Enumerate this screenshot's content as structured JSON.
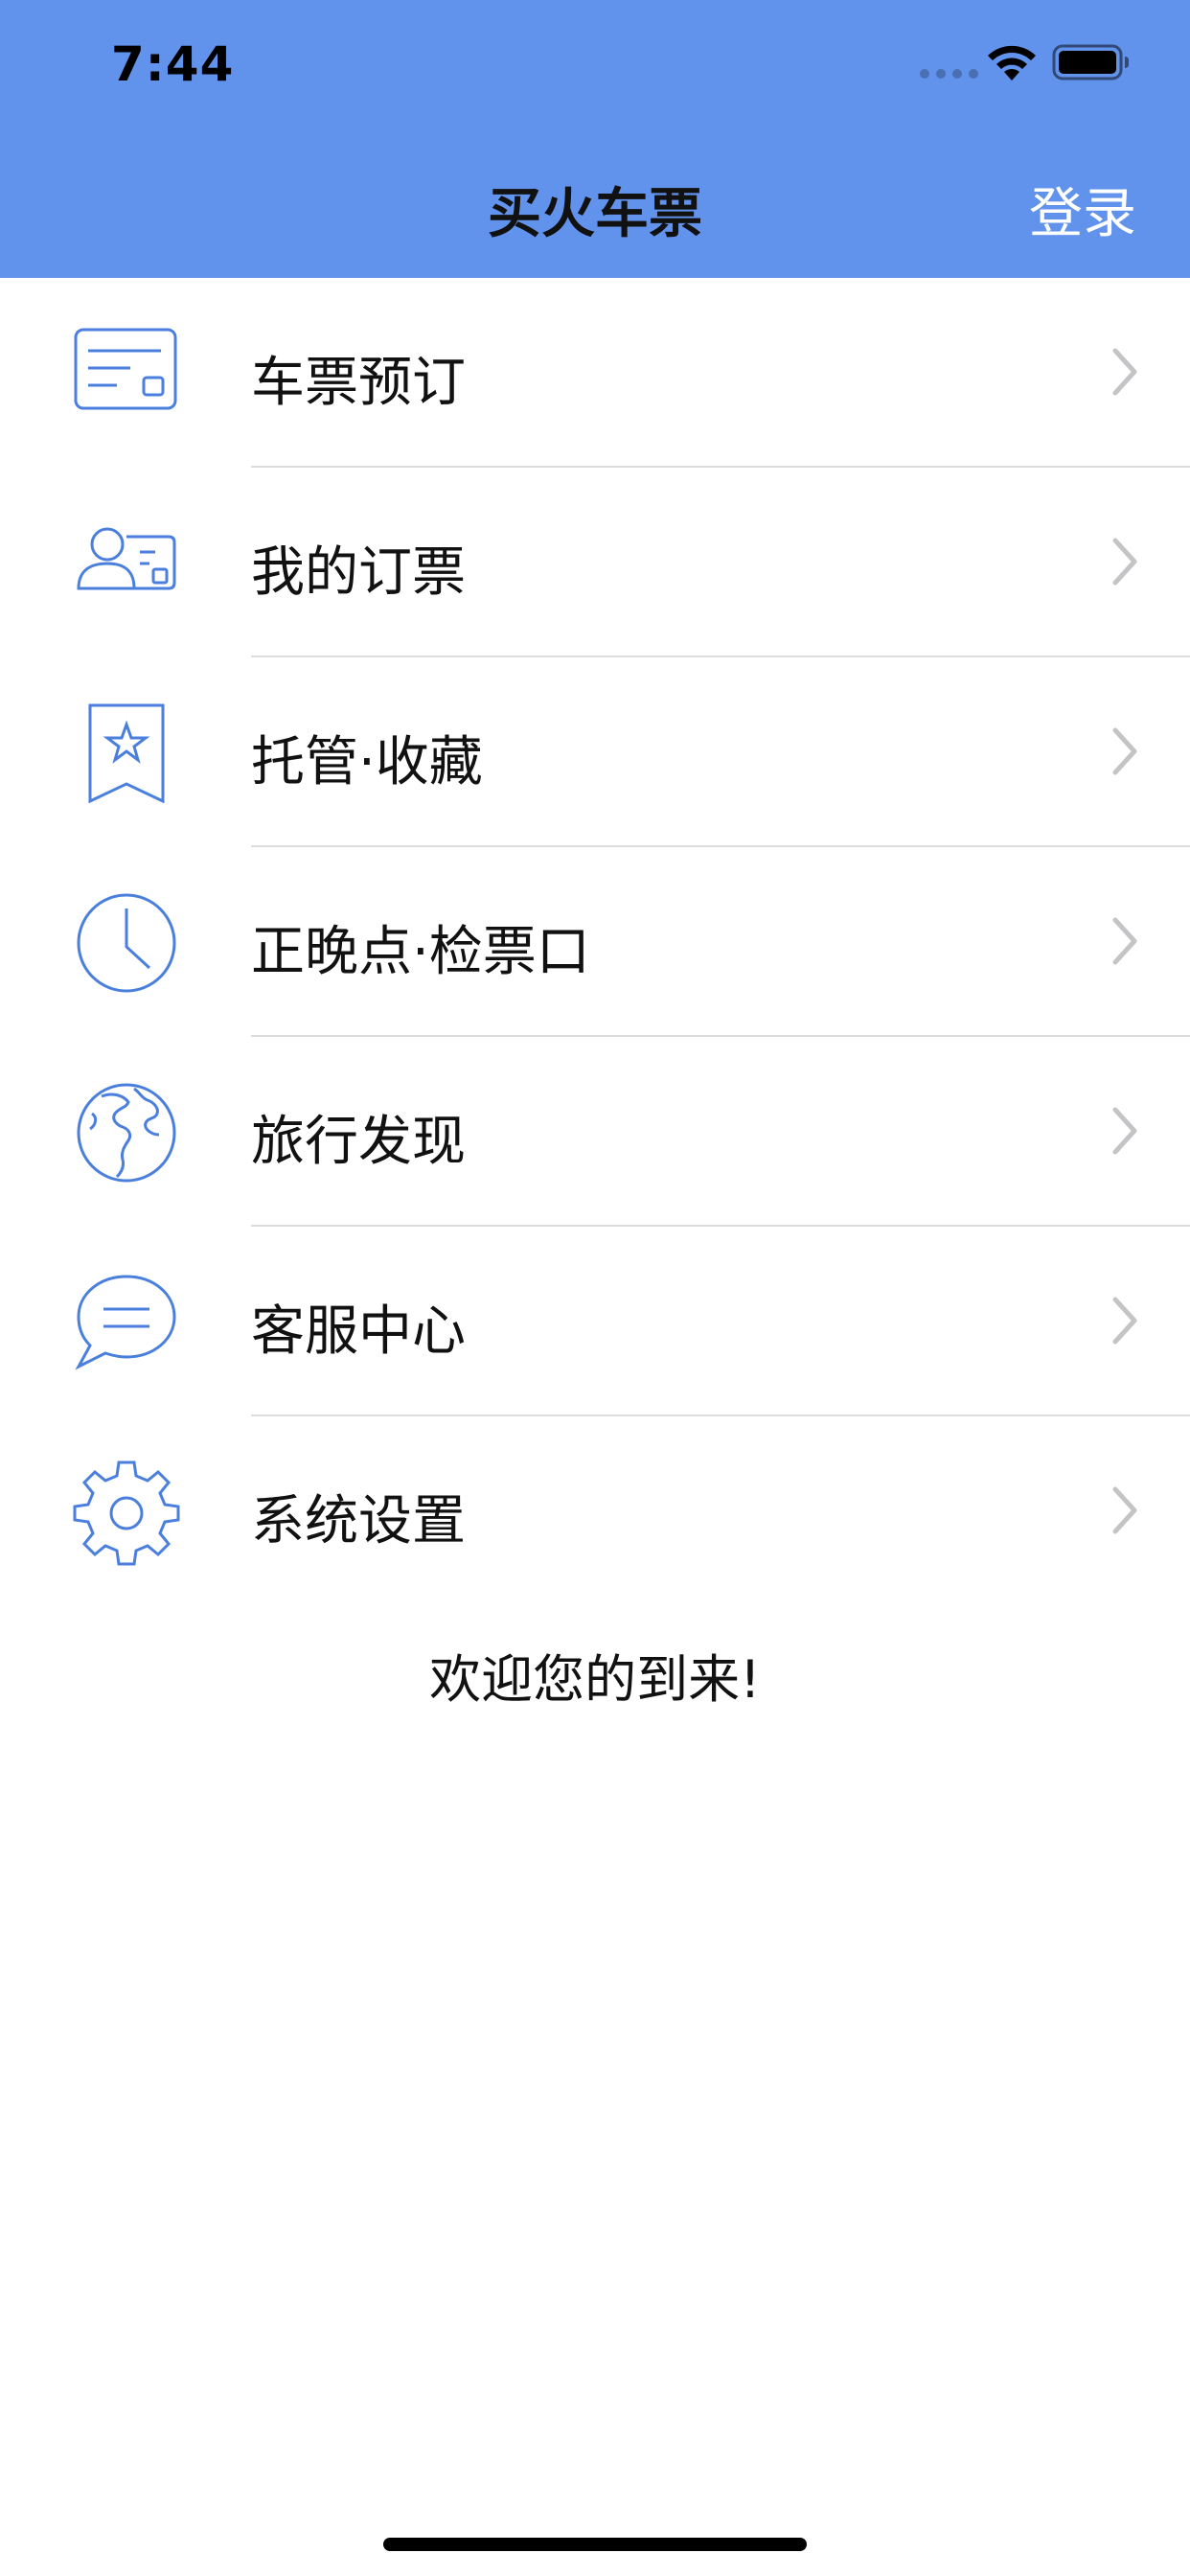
{
  "status_bar": {
    "time": "7:44",
    "wifi_icon": "wifi-icon",
    "battery_icon": "battery-icon"
  },
  "nav": {
    "title": "买火车票",
    "login_label": "登录"
  },
  "menu": {
    "items": [
      {
        "label": "车票预订",
        "icon": "ticket-icon"
      },
      {
        "label": "我的订票",
        "icon": "user-card-icon"
      },
      {
        "label": "托管·收藏",
        "icon": "bookmark-star-icon"
      },
      {
        "label": "正晚点·检票口",
        "icon": "clock-icon"
      },
      {
        "label": "旅行发现",
        "icon": "globe-icon"
      },
      {
        "label": "客服中心",
        "icon": "chat-bubble-icon"
      },
      {
        "label": "系统设置",
        "icon": "gear-icon"
      }
    ]
  },
  "welcome_text": "欢迎您的到来!",
  "colors": {
    "header_bg": "#6193ec",
    "icon_blue": "#4a7fde",
    "chevron_gray": "#c4c4c7",
    "divider": "#dcdcdc"
  }
}
